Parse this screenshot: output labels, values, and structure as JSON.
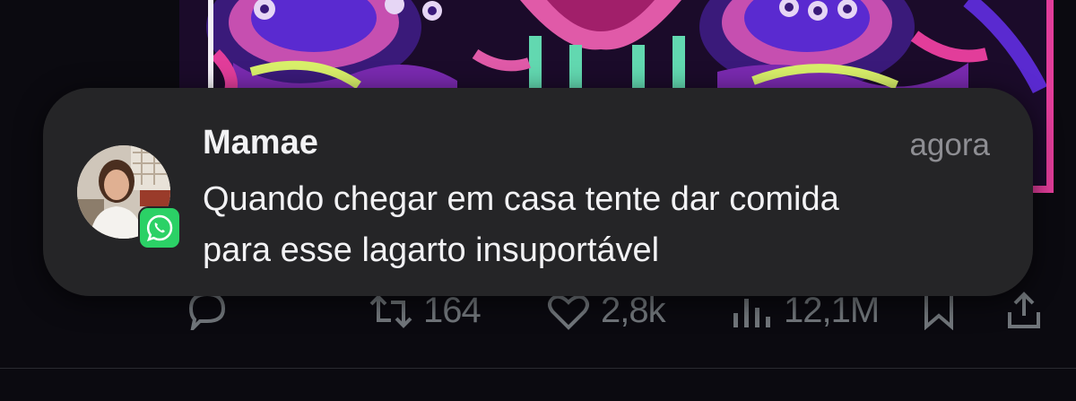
{
  "notification": {
    "app_icon": "whatsapp-icon",
    "sender": "Mamae",
    "time": "agora",
    "message": "Quando chegar em casa tente dar comida\npara esse lagarto insuportável"
  },
  "post_actions": {
    "reply_icon": "reply-icon",
    "retweets": "164",
    "likes": "2,8k",
    "views": "12,1M",
    "bookmark_icon": "bookmark-icon",
    "share_icon": "share-icon"
  },
  "colors": {
    "notification_bg": "#252527",
    "whatsapp_green": "#2bd166",
    "background": "#0b0a10",
    "muted": "#71767b"
  }
}
